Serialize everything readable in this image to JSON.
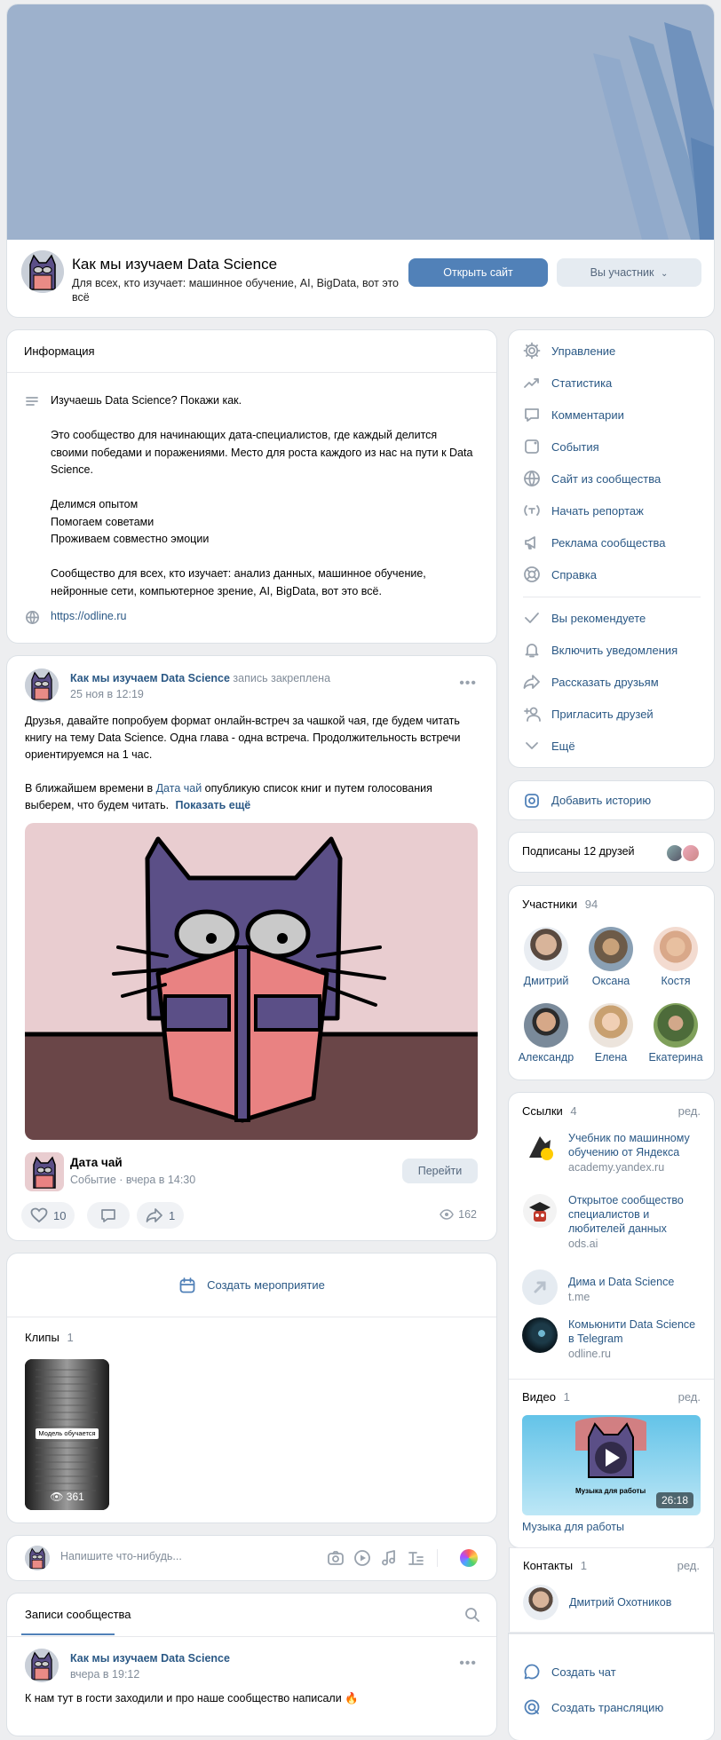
{
  "group": {
    "title": "Как мы изучаем Data Science",
    "description": "Для всех, кто изучает: машинное обучение, AI, BigData, вот это всё",
    "open_site_label": "Открыть сайт",
    "member_label": "Вы участник"
  },
  "info": {
    "heading": "Информация",
    "text": "Изучаешь Data Science? Покажи как.\n\nЭто сообщество для начинающих дата-специалистов, где каждый делится своими победами и поражениями. Место для роста каждого из нас на пути к Data Science.\n\nДелимся опытом\nПомогаем советами\nПроживаем совместно эмоции\n\nСообщество для всех, кто изучает: анализ данных, машинное обучение, нейронные сети, компьютерное зрение, AI, BigData, вот это всё.",
    "url": "https://odline.ru"
  },
  "pinned_post": {
    "author": "Как мы изучаем Data Science",
    "pinned_note": "запись закреплена",
    "date": "25 ноя в 12:19",
    "text_p1": "Друзья, давайте попробуем формат онлайн-встреч за чашкой чая, где будем читать книгу на тему Data Science. Одна глава - одна встреча. Продолжительность встречи ориентируемся на 1 час.",
    "text_p2_before": "В ближайшем времени в ",
    "text_p2_link": "Дата чай",
    "text_p2_after": " опубликую список книг и путем голосования выберем, что будем читать.",
    "show_more": "Показать ещё",
    "event_title": "Дата чай",
    "event_meta": "Событие · вчера в 14:30",
    "event_button": "Перейти",
    "likes": "10",
    "shares": "1",
    "views": "162"
  },
  "create_event_label": "Создать мероприятие",
  "clips": {
    "heading": "Клипы",
    "count": "1",
    "clip_caption": "Модель обучается",
    "clip_views": "361"
  },
  "composer": {
    "placeholder": "Напишите что-нибудь..."
  },
  "wall": {
    "tab": "Записи сообщества",
    "author": "Как мы изучаем Data Science",
    "date": "вчера в 19:12",
    "text": "К нам тут в гости заходили и про наше сообщество написали"
  },
  "menu": {
    "items": [
      {
        "label": "Управление",
        "icon": "gear-icon"
      },
      {
        "label": "Статистика",
        "icon": "trend-icon"
      },
      {
        "label": "Комментарии",
        "icon": "comment-icon"
      },
      {
        "label": "События",
        "icon": "event-icon"
      },
      {
        "label": "Сайт из сообщества",
        "icon": "globe-icon"
      },
      {
        "label": "Начать репортаж",
        "icon": "broadcast-icon"
      },
      {
        "label": "Реклама сообщества",
        "icon": "megaphone-icon"
      },
      {
        "label": "Справка",
        "icon": "help-icon"
      }
    ],
    "items2": [
      {
        "label": "Вы рекомендуете",
        "icon": "check-icon"
      },
      {
        "label": "Включить уведомления",
        "icon": "bell-icon"
      },
      {
        "label": "Рассказать друзьям",
        "icon": "share-icon"
      },
      {
        "label": "Пригласить друзей",
        "icon": "add-user-icon"
      },
      {
        "label": "Ещё",
        "icon": "chevron-down-icon"
      }
    ]
  },
  "add_story": "Добавить историю",
  "friends_subscribed": "Подписаны 12 друзей",
  "members": {
    "heading": "Участники",
    "count": "94",
    "list": [
      "Дмитрий",
      "Оксана",
      "Костя",
      "Александр",
      "Елена",
      "Екатерина"
    ]
  },
  "links": {
    "heading": "Ссылки",
    "count": "4",
    "edit": "ред.",
    "list": [
      {
        "title": "Учебник по машинному обучению от Яндекса",
        "domain": "academy.yandex.ru"
      },
      {
        "title": "Открытое сообщество специалистов и любителей данных",
        "domain": "ods.ai"
      },
      {
        "title": "Дима и Data Science",
        "domain": "t.me"
      },
      {
        "title": "Комьюнити Data Science в Telegram",
        "domain": "odline.ru"
      }
    ]
  },
  "video": {
    "heading": "Видео",
    "count": "1",
    "edit": "ред.",
    "title": "Музыка для работы",
    "overlay": "Музыка для работы",
    "duration": "26:18"
  },
  "contacts": {
    "heading": "Контакты",
    "count": "1",
    "edit": "ред.",
    "name": "Дмитрий Охотников"
  },
  "bottom_actions": {
    "create_chat": "Создать чат",
    "create_stream": "Создать трансляцию"
  },
  "colors": {
    "accent": "#5181b8",
    "link": "#2a5885",
    "bg": "#edeef0",
    "cover": "#9db1cc"
  }
}
